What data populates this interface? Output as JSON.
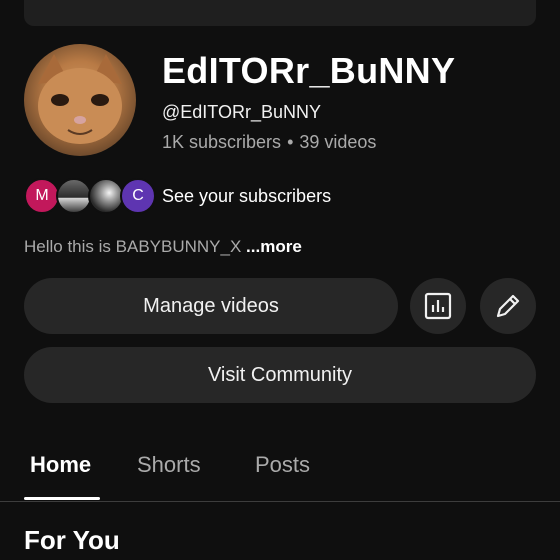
{
  "channel": {
    "name": "EdITORr_BuNNY",
    "handle": "@EdITORr_BuNNY",
    "subscribers": "1K subscribers",
    "separator": "•",
    "videos": "39 videos"
  },
  "subscribers_row": {
    "avatar_letters": [
      "M",
      "C"
    ],
    "label": "See your subscribers"
  },
  "bio": {
    "text": "Hello this is BABYBUNNY_X ",
    "more": "...more"
  },
  "actions": {
    "manage_videos": "Manage videos",
    "analytics_icon": "analytics-icon",
    "edit_icon": "pencil-icon",
    "visit_community": "Visit Community"
  },
  "tabs": [
    "Home",
    "Shorts",
    "Posts"
  ],
  "section": {
    "title": "For You"
  },
  "colors": {
    "background": "#0f0f0f",
    "button": "#272727",
    "secondary_text": "#aaaaaa",
    "avatar_m": "#c2185b",
    "avatar_c": "#5e35b1"
  }
}
